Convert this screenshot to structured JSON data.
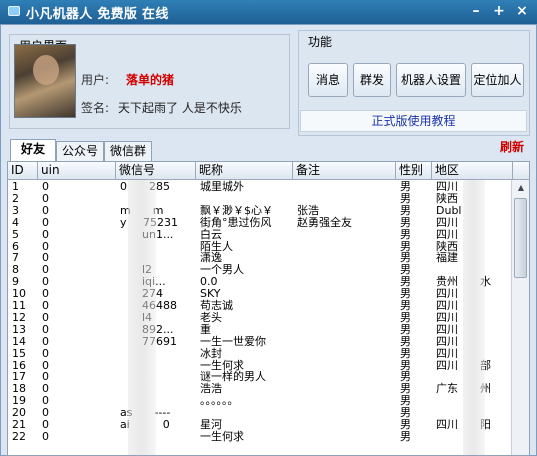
{
  "window": {
    "title": "小凡机器人 免费版 在线"
  },
  "user_panel": {
    "title": "用户界面",
    "user_label": "用户:",
    "user_name": "落单的猪",
    "sign_label": "签名:",
    "sign_text": "天下起雨了  人是不快乐"
  },
  "function_panel": {
    "title": "功能",
    "buttons": [
      "消息",
      "群发",
      "机器人设置",
      "定位加人"
    ],
    "tutorial_button": "正式版使用教程"
  },
  "tabs": [
    "好友",
    "公众号",
    "微信群"
  ],
  "refresh_label": "刷新",
  "columns": [
    "ID",
    "uin",
    "微信号",
    "昵称",
    "备注",
    "性别",
    "地区"
  ],
  "rows": [
    [
      "1",
      "0",
      "0    285",
      "城里城外",
      "",
      "男",
      "四川"
    ],
    [
      "2",
      "0",
      "",
      "",
      "",
      "男",
      "陕西"
    ],
    [
      "3",
      "0",
      "m    m",
      "飘￥渺￥$心￥",
      "张浩",
      "男",
      "Dubl"
    ],
    [
      "4",
      "0",
      "y   75231",
      "街角°患过伤风",
      "赵勇强全友",
      "男",
      "四川"
    ],
    [
      "5",
      "0",
      "    un1...",
      "白云",
      "",
      "男",
      "四川"
    ],
    [
      "6",
      "0",
      "",
      "陌生人",
      "",
      "男",
      "陕西"
    ],
    [
      "7",
      "0",
      "",
      "潇逸",
      "",
      "男",
      "福建"
    ],
    [
      "8",
      "0",
      "    l2",
      "一个男人",
      "",
      "男",
      ""
    ],
    [
      "9",
      "0",
      "    iqi...",
      "0.0",
      "",
      "男",
      "贵州    水"
    ],
    [
      "10",
      "0",
      "    274",
      "SKY",
      "",
      "男",
      "四川"
    ],
    [
      "11",
      "0",
      "    46488",
      "苟志诚",
      "",
      "男",
      "四川"
    ],
    [
      "12",
      "0",
      "    l4",
      "老头",
      "",
      "男",
      "四川"
    ],
    [
      "13",
      "0",
      "    892...",
      "重",
      "",
      "男",
      "四川"
    ],
    [
      "14",
      "0",
      "    77691",
      "一生一世爱你",
      "",
      "男",
      "四川"
    ],
    [
      "15",
      "0",
      "",
      "冰封",
      "",
      "男",
      "四川"
    ],
    [
      "16",
      "0",
      "",
      "一生何求",
      "",
      "男",
      "四川    部"
    ],
    [
      "17",
      "0",
      "",
      "谜一样的男人",
      "",
      "男",
      ""
    ],
    [
      "18",
      "0",
      "",
      "浩浩",
      "",
      "男",
      "广东    州"
    ],
    [
      "19",
      "0",
      "",
      "。。。。。。",
      "",
      "男",
      ""
    ],
    [
      "20",
      "0",
      "as    ----",
      "",
      "",
      "男",
      ""
    ],
    [
      "21",
      "0",
      "ai      0",
      "星河",
      "",
      "男",
      "四川    阳"
    ],
    [
      "22",
      "0",
      "",
      "一生何求",
      "",
      "男",
      ""
    ]
  ],
  "colors": {
    "titlebar": "#2f7fb6",
    "username": "#d00000",
    "refresh": "#d00000",
    "tutorial_text": "#1a33aa"
  }
}
